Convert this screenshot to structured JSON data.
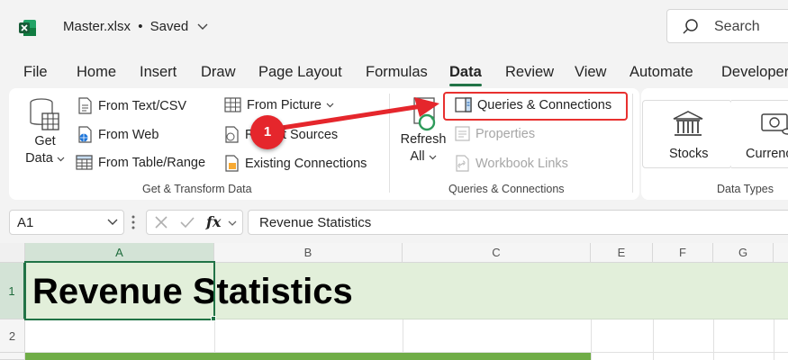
{
  "titlebar": {
    "filename": "Master.xlsx",
    "separator": "•",
    "status": "Saved",
    "search_label": "Search"
  },
  "tabs": [
    "File",
    "Home",
    "Insert",
    "Draw",
    "Page Layout",
    "Formulas",
    "Data",
    "Review",
    "View",
    "Automate",
    "Developer"
  ],
  "active_tab": "Data",
  "ribbon": {
    "get_data_line1": "Get",
    "get_data_line2": "Data",
    "from_text_csv": "From Text/CSV",
    "from_web": "From Web",
    "from_table_range": "From Table/Range",
    "from_picture": "From Picture",
    "recent_sources": "Recent Sources",
    "existing_connections": "Existing Connections",
    "group_get_transform": "Get & Transform Data",
    "refresh_line1": "Refresh",
    "refresh_line2": "All",
    "queries_connections": "Queries & Connections",
    "properties": "Properties",
    "workbook_links": "Workbook Links",
    "group_queries": "Queries & Connections",
    "stocks": "Stocks",
    "currencies": "Currencies",
    "group_data_types": "Data Types"
  },
  "formula_bar": {
    "name_box": "A1",
    "fx": "fx",
    "formula": "Revenue Statistics"
  },
  "grid": {
    "columns": [
      "A",
      "B",
      "C",
      "E",
      "F",
      "G"
    ],
    "rows": [
      "1",
      "2"
    ],
    "a1_value": "Revenue Statistics"
  },
  "callout": {
    "number": "1"
  },
  "colors": {
    "accent": "#217346",
    "highlight": "#e8302f",
    "row_fill": "#e2efda",
    "band_fill": "#70ad47"
  }
}
